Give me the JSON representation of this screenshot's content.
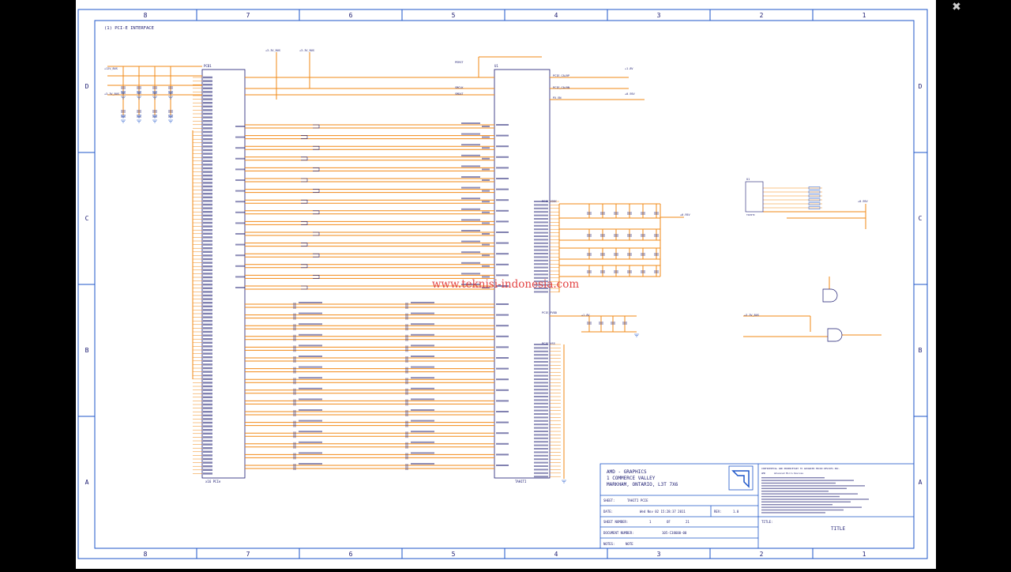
{
  "viewer": {
    "close_icon": "close-icon"
  },
  "colors": {
    "border": "#1e56c9",
    "wire": "#f28a16",
    "text": "#1a1a70",
    "watermark": "#e03030",
    "paper": "#ffffff"
  },
  "schematic": {
    "section_title": "(1) PCI-E INTERFACE",
    "columns": [
      "8",
      "7",
      "6",
      "5",
      "4",
      "3",
      "2",
      "1"
    ],
    "rows": [
      "D",
      "C",
      "B",
      "A"
    ],
    "watermark": "www.teknisi-indonesia.com",
    "left_chip": {
      "ref": "PCB1",
      "footer": "x16 PCIe"
    },
    "right_chip": {
      "ref": "U1",
      "footer": "TAHITI"
    },
    "side_chip": {
      "ref": "U1",
      "footer": "TAHITI"
    },
    "power_labels": [
      "+12V_BUS",
      "+3.3V_BUS",
      "+3.3V_BUS",
      "+3.3V_BUS",
      "+1.8V",
      "+0.95V",
      "+1.8V",
      "+0.95V",
      "+0.95V",
      "+3.3V_BUS"
    ],
    "net_labels": [
      "PERST",
      "SMCLK",
      "SMDAT",
      "PCIE_CALRP",
      "PCIE_CALRN",
      "PX_EN",
      "PCIE_VDDC",
      "PCIE_PVDD",
      "PCIE_VSS"
    ],
    "title_block": {
      "company": "AMD - GRAPHICS",
      "address1": "1 COMMERCE VALLEY",
      "address2": "MARKHAM, ONTARIO, L3T 7X6",
      "sheet_label": "SHEET:",
      "sheet_value": "TAHITI PCIE",
      "date_label": "DATE:",
      "date_value": "Wed Nov 02 15:28:37 2011",
      "rev_label": "REV:",
      "rev_value": "1.0",
      "sheet_number_label": "SHEET NUMBER:",
      "sheet_number": "1",
      "of_label": "OF",
      "sheet_total": "21",
      "doc_label": "DOCUMENT NUMBER:",
      "doc_value": "105-C38600-00",
      "notes_label": "NOTES:",
      "notes_value": "NOTE",
      "title_label": "TITLE:",
      "title_value": "TITLE",
      "confidential": "CONFIDENTIAL AND PROPRIETARY TO ADVANCED MICRO DEVICES INC.",
      "amd_label": "AMD",
      "amd_desc": "Advanced Micro Devices"
    }
  }
}
